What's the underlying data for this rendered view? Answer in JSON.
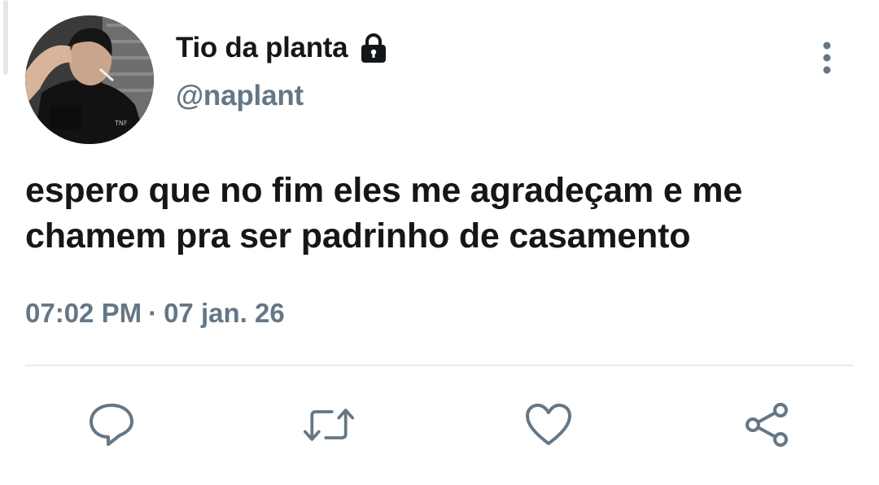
{
  "tweet": {
    "author": {
      "display_name": "Tio da planta",
      "handle": "@naplant",
      "protected_icon": "lock-icon"
    },
    "text": "espero que no fim eles me agradeçam e me chamem pra ser padrinho de casamento",
    "time": "07:02 PM",
    "separator": "·",
    "date": "07 jan. 26"
  },
  "actions": {
    "reply_icon": "reply-icon",
    "retweet_icon": "retweet-icon",
    "like_icon": "heart-icon",
    "share_icon": "share-icon",
    "more_icon": "more-vertical-icon"
  },
  "colors": {
    "text_primary": "#14171a",
    "text_secondary": "#657786",
    "divider": "#e6ecf0"
  }
}
